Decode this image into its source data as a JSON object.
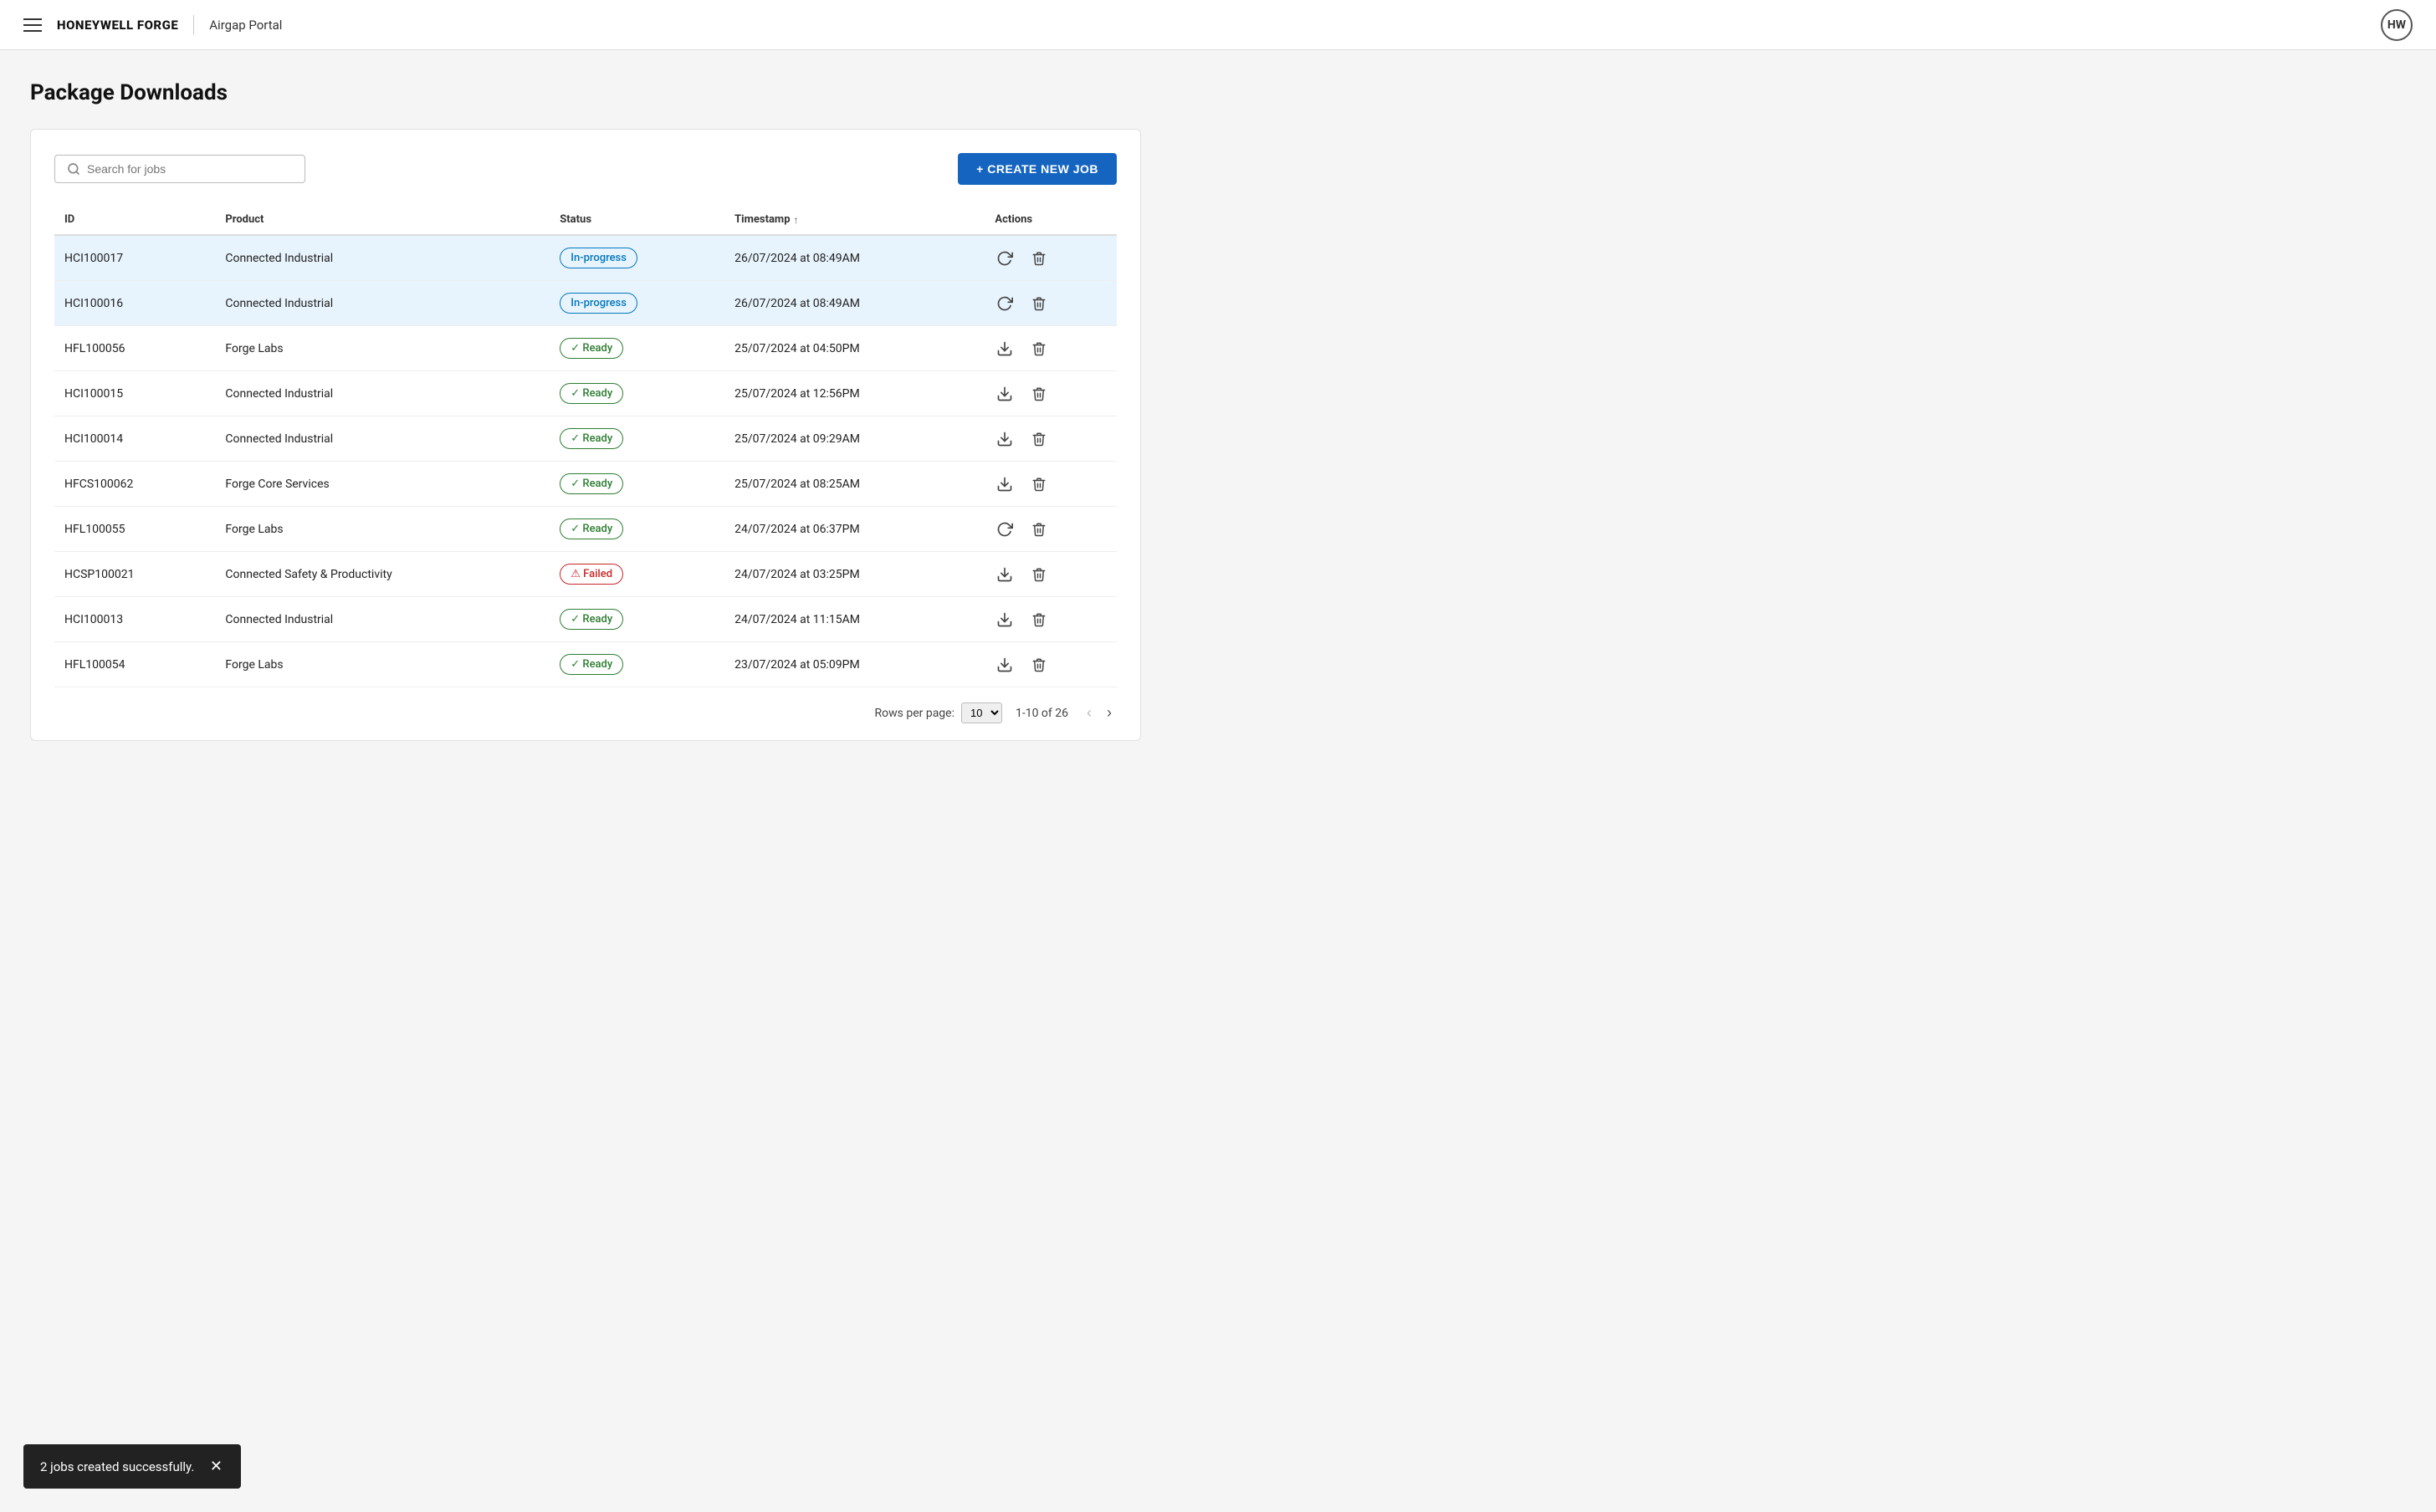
{
  "header": {
    "brand": "HONEYWELL FORGE",
    "portal": "Airgap Portal",
    "avatar_initials": "HW"
  },
  "page": {
    "title": "Package Downloads"
  },
  "toolbar": {
    "search_placeholder": "Search for jobs",
    "create_button_label": "+ CREATE NEW JOB"
  },
  "table": {
    "columns": [
      "ID",
      "Product",
      "Status",
      "Timestamp",
      "Actions"
    ],
    "rows": [
      {
        "id": "HCI100017",
        "product": "Connected Industrial",
        "status": "In-progress",
        "status_type": "inprogress",
        "timestamp": "26/07/2024 at 08:49AM",
        "highlight": true
      },
      {
        "id": "HCI100016",
        "product": "Connected Industrial",
        "status": "In-progress",
        "status_type": "inprogress",
        "timestamp": "26/07/2024 at 08:49AM",
        "highlight": true
      },
      {
        "id": "HFL100056",
        "product": "Forge Labs",
        "status": "Ready",
        "status_type": "ready",
        "timestamp": "25/07/2024 at 04:50PM",
        "highlight": false
      },
      {
        "id": "HCI100015",
        "product": "Connected Industrial",
        "status": "Ready",
        "status_type": "ready",
        "timestamp": "25/07/2024 at 12:56PM",
        "highlight": false
      },
      {
        "id": "HCI100014",
        "product": "Connected Industrial",
        "status": "Ready",
        "status_type": "ready",
        "timestamp": "25/07/2024 at 09:29AM",
        "highlight": false
      },
      {
        "id": "HFCS100062",
        "product": "Forge Core Services",
        "status": "Ready",
        "status_type": "ready",
        "timestamp": "25/07/2024 at 08:25AM",
        "highlight": false
      },
      {
        "id": "HFL100055",
        "product": "Forge Labs",
        "status": "Ready",
        "status_type": "ready",
        "timestamp": "24/07/2024 at 06:37PM",
        "highlight": false
      },
      {
        "id": "HCSP100021",
        "product": "Connected Safety & Productivity",
        "status": "Failed",
        "status_type": "failed",
        "timestamp": "24/07/2024 at 03:25PM",
        "highlight": false
      },
      {
        "id": "HCI100013",
        "product": "Connected Industrial",
        "status": "Ready",
        "status_type": "ready",
        "timestamp": "24/07/2024 at 11:15AM",
        "highlight": false
      },
      {
        "id": "HFL100054",
        "product": "Forge Labs",
        "status": "Ready",
        "status_type": "ready",
        "timestamp": "23/07/2024 at 05:09PM",
        "highlight": false
      }
    ]
  },
  "pagination": {
    "rows_per_page_label": "Rows per page:",
    "rows_per_page": "10",
    "range_label": "1-10 of 26"
  },
  "snackbar": {
    "message": "2 jobs created successfully."
  }
}
